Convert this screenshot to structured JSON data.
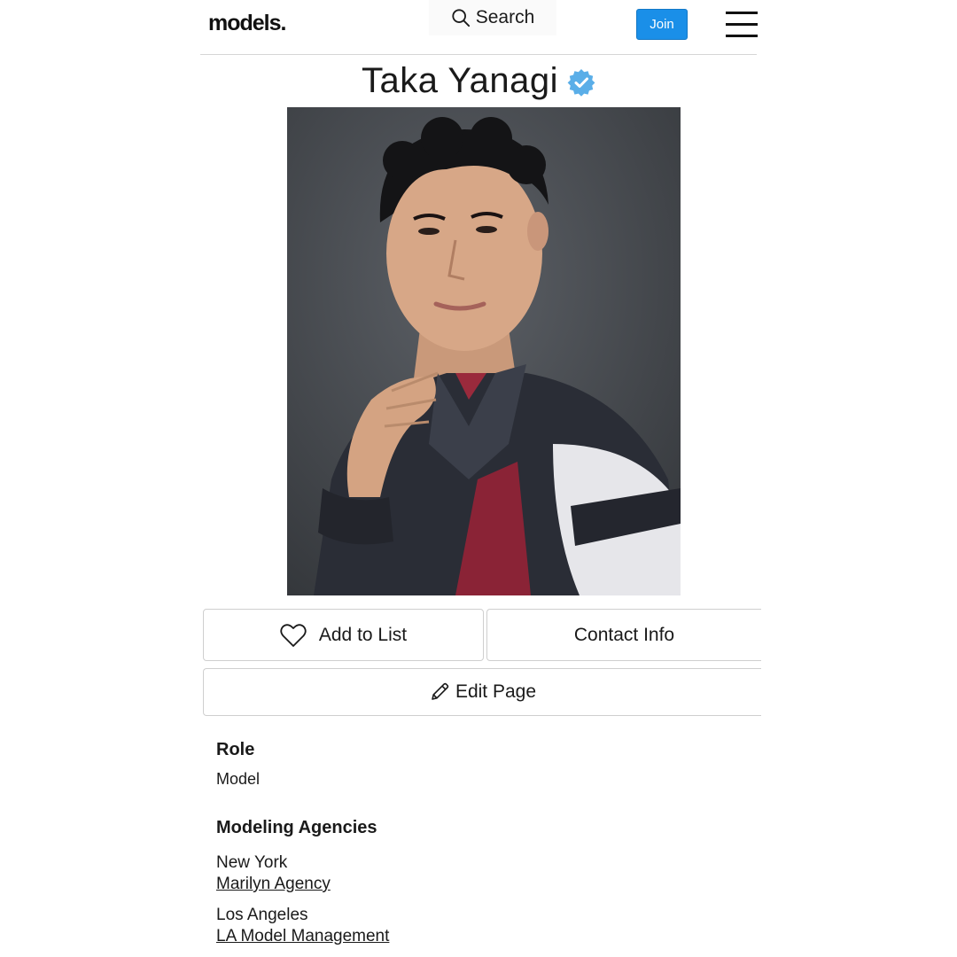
{
  "header": {
    "logo": "models.",
    "search_label": "Search",
    "join_label": "Join"
  },
  "profile": {
    "name": "Taka Yanagi",
    "verified": true
  },
  "actions": {
    "add_to_list": "Add to List",
    "contact_info": "Contact Info",
    "edit_page": "Edit Page"
  },
  "details": {
    "role_heading": "Role",
    "role_value": "Model",
    "agencies_heading": "Modeling Agencies",
    "agencies": [
      {
        "city": "New York",
        "agency": "Marilyn Agency"
      },
      {
        "city": "Los Angeles",
        "agency": "LA Model Management"
      }
    ]
  },
  "colors": {
    "accent": "#1a8fe8",
    "verified_badge": "#5aaee8"
  },
  "icons": {
    "search": "search-icon",
    "menu": "hamburger-menu-icon",
    "verified": "verified-badge-icon",
    "heart": "heart-icon",
    "pencil": "pencil-icon"
  }
}
